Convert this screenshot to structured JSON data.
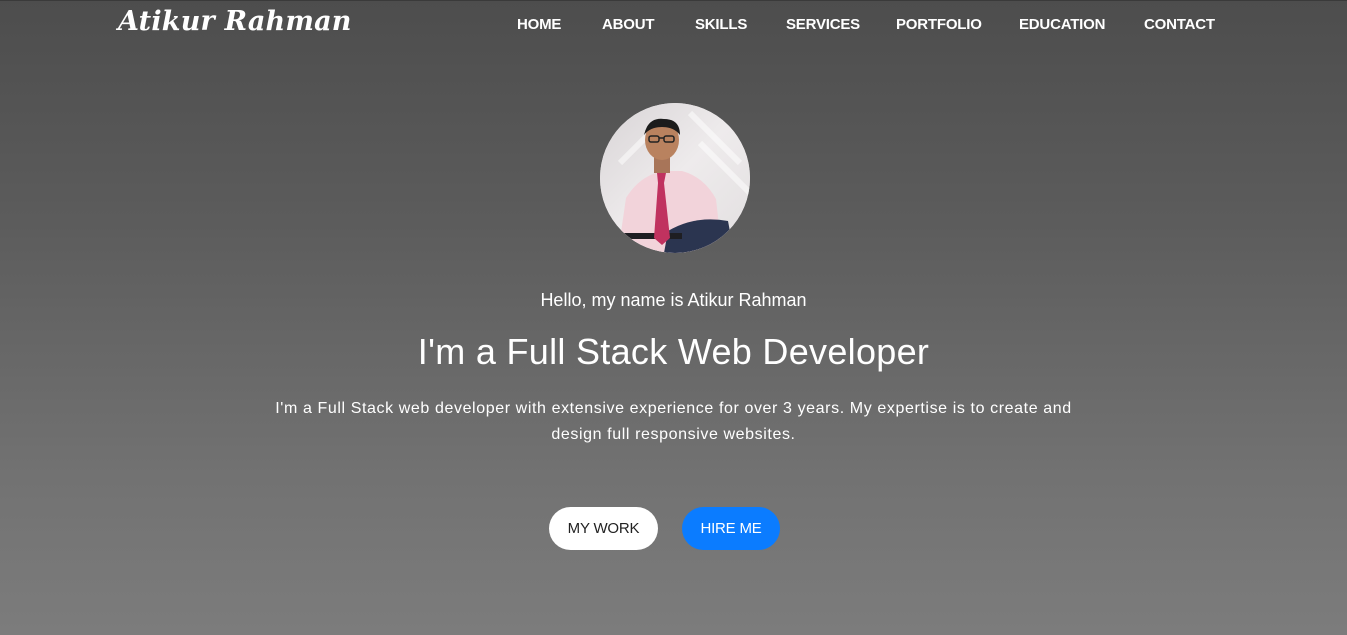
{
  "header": {
    "brand": "Atikur Rahman",
    "nav": [
      {
        "label": "HOME"
      },
      {
        "label": "ABOUT"
      },
      {
        "label": "SKILLS"
      },
      {
        "label": "SERVICES"
      },
      {
        "label": "PORTFOLIO"
      },
      {
        "label": "EDUCATION"
      },
      {
        "label": "CONTACT"
      }
    ]
  },
  "hero": {
    "avatar_icon": "profile-photo",
    "greeting": "Hello, my name is Atikur Rahman",
    "headline": "I'm a Full Stack Web Developer",
    "description": "I'm a Full Stack web developer with extensive experience for over 3 years. My expertise is to create and design full responsive websites.",
    "buttons": {
      "my_work": "MY WORK",
      "hire_me": "HIRE ME"
    }
  },
  "colors": {
    "accent": "#0b7cff",
    "background_top": "#4d4d4d",
    "background_bottom": "#7c7c7c"
  }
}
